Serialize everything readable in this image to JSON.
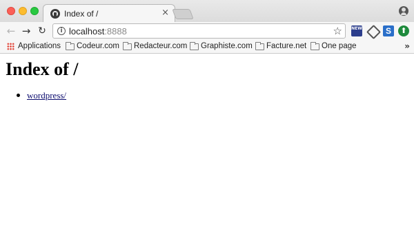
{
  "tab": {
    "title": "Index of /",
    "close_glyph": "×"
  },
  "toolbar": {
    "back_glyph": "←",
    "forward_glyph": "→",
    "reload_glyph": "↻",
    "url_host": "localhost",
    "url_port": ":8888",
    "info_glyph": "i",
    "star_glyph": "☆"
  },
  "extensions": {
    "new_label": "NEW",
    "s_label": "S",
    "up_glyph": "⬆"
  },
  "bookmarks": {
    "items": [
      {
        "label": "Applications",
        "icon": "apps-grid-icon"
      },
      {
        "label": "Codeur.com",
        "icon": "folder-icon"
      },
      {
        "label": "Redacteur.com",
        "icon": "folder-icon"
      },
      {
        "label": "Graphiste.com",
        "icon": "folder-icon"
      },
      {
        "label": "Facture.net",
        "icon": "folder-icon"
      },
      {
        "label": "One page",
        "icon": "folder-icon"
      }
    ],
    "more_glyph": "»"
  },
  "page": {
    "heading": "Index of /",
    "entries": [
      {
        "label": "wordpress/"
      }
    ]
  }
}
